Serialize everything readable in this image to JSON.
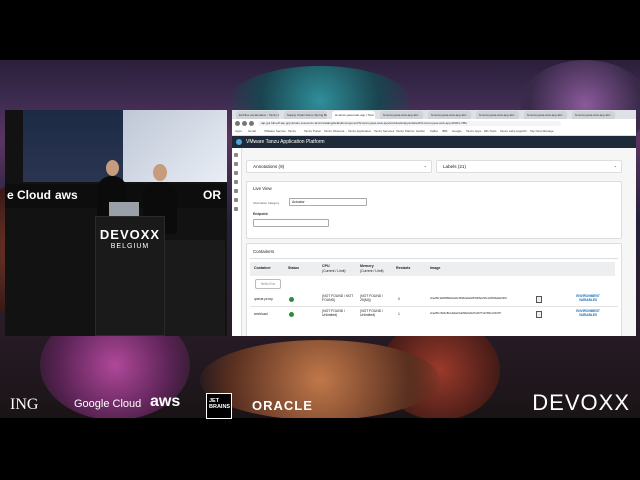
{
  "stage": {
    "podium_brand": "DEVOXX",
    "podium_sub": "BELGIUM",
    "logo_left_1": "e Cloud",
    "logo_left_2": "aws",
    "logo_left_3": "OR"
  },
  "browser": {
    "tabs": [
      "Ev/Nice acceleration - Tanzu Ap",
      "Supply Chain Demo Spring Boot",
      "Hi-tanzu-java-web-app | Tanz",
      "hi-tanzu-java-web-app-abc",
      "hi-tanzu-java-web-app-abc",
      "hi-tanzu-java-web-app-abc",
      "hi-tanzu-java-web-app-abc",
      "hi-tanzu-java-web-app-abc"
    ],
    "address": "tap-gui.full.edf-tap.gcp.dandu.soa-tanzu.tanzu/catalog/default/component/hi-tanzu-java-web-app/workloads/apps/default/hi-tanzu-java-web-app-00001-7f8a",
    "bookmarks": [
      "Apps",
      "Gmail",
      "VMware Service",
      "Tanzu",
      "Tanzu Portal",
      "Tanzu Observa...",
      "Tanzu Application",
      "Tanzu Services",
      "Tanzu Partner",
      "Harbor",
      "Kafka",
      "IBM",
      "Google",
      "Tanzu Apps",
      "k8s Tools",
      "Tanzu Labs",
      "ArgoCD",
      "Tap Next Manage"
    ],
    "app_title": "VMware Tanzu Application Platform"
  },
  "app": {
    "annotations_label": "Annotations (9)",
    "labels_label": "Labels (21)",
    "live_view_title": "Live View",
    "info_category_label": "Information Category",
    "info_category_value": "Actuator",
    "endpoint_label": "Endpoint",
    "endpoint_value": "",
    "containers_title": "Containers",
    "action_button": "Hello Env",
    "columns": [
      "Container",
      "Status",
      "CPU",
      "Memory",
      "Restarts",
      "Image"
    ],
    "column_subs": [
      "",
      "",
      "(Current / Limit)",
      "(Current / Limit)",
      "",
      ""
    ],
    "rows": [
      {
        "container": "queue-proxy",
        "cpu": "(NOT FOUND / NOT FOUND)",
        "memory": "(NOT FOUND / 25(Mi))",
        "restarts": "0",
        "image": "sha256:3a5b886e0a2bcf3962a0a46879b8e23bcd4b5f4a9ebf39f",
        "env": "ENVIRONMENT VARIABLES"
      },
      {
        "container": "workload",
        "cpu": "(NOT FOUND / Unlimited)",
        "memory": "(NOT FOUND / Unlimited)",
        "restarts": "1",
        "image": "sha256:c5d4c8bcde6a01de58e0a5d7cd9771d70fbcc0b378",
        "env": "ENVIRONMENT VARIABLES"
      }
    ]
  },
  "sponsors": [
    "ING",
    "Google Cloud",
    "aws",
    "JET BRAINS",
    "ORACLE",
    "DEVOXX"
  ],
  "colors": {
    "accent": "#1b6fb8",
    "status_ok": "#2e8b3a",
    "app_header": "#1f2a38"
  }
}
